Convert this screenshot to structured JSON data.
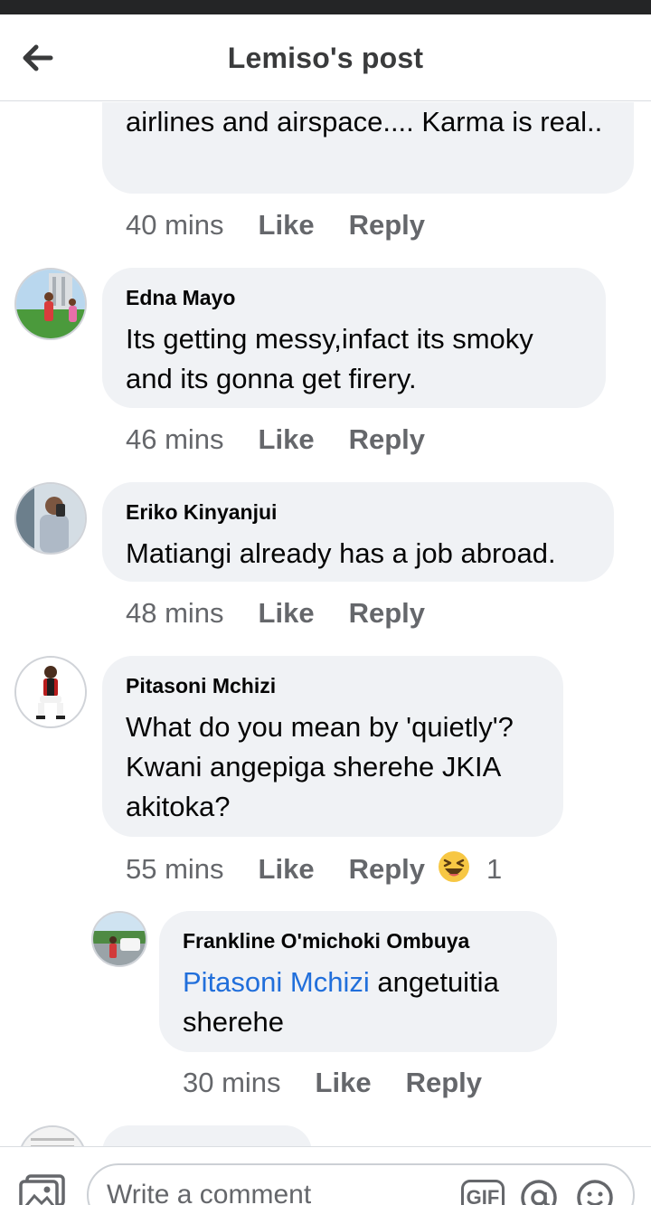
{
  "header": {
    "title": "Lemiso's post"
  },
  "comments": [
    {
      "name": "",
      "text": "airlines and airspace.... Karma is real..",
      "time": "40 mins",
      "like": "Like",
      "reply": "Reply"
    },
    {
      "name": "Edna Mayo",
      "text": "Its getting messy,infact its smoky and its gonna get firery.",
      "time": "46 mins",
      "like": "Like",
      "reply": "Reply"
    },
    {
      "name": "Eriko Kinyanjui",
      "text": "Matiangi already has a job abroad.",
      "time": "48 mins",
      "like": "Like",
      "reply": "Reply"
    },
    {
      "name": "Pitasoni Mchizi",
      "text": "What do you mean by 'quietly'? Kwani angepiga sherehe JKIA akitoka?",
      "time": "55 mins",
      "like": "Like",
      "reply": "Reply",
      "reaction_icon": "laughing-emoji-icon",
      "reaction_count": "1"
    }
  ],
  "reply": {
    "name": "Frankline O'michoki Ombuya",
    "mention": "Pitasoni Mchizi",
    "text": " angetuitia sherehe",
    "time": "30 mins",
    "like": "Like",
    "reply": "Reply"
  },
  "composer": {
    "placeholder": "Write a comment",
    "gif_label": "GIF"
  },
  "colors": {
    "bubble": "#f0f2f5",
    "meta": "#65676b",
    "mention": "#216fdb",
    "status_bar": "#242526"
  }
}
